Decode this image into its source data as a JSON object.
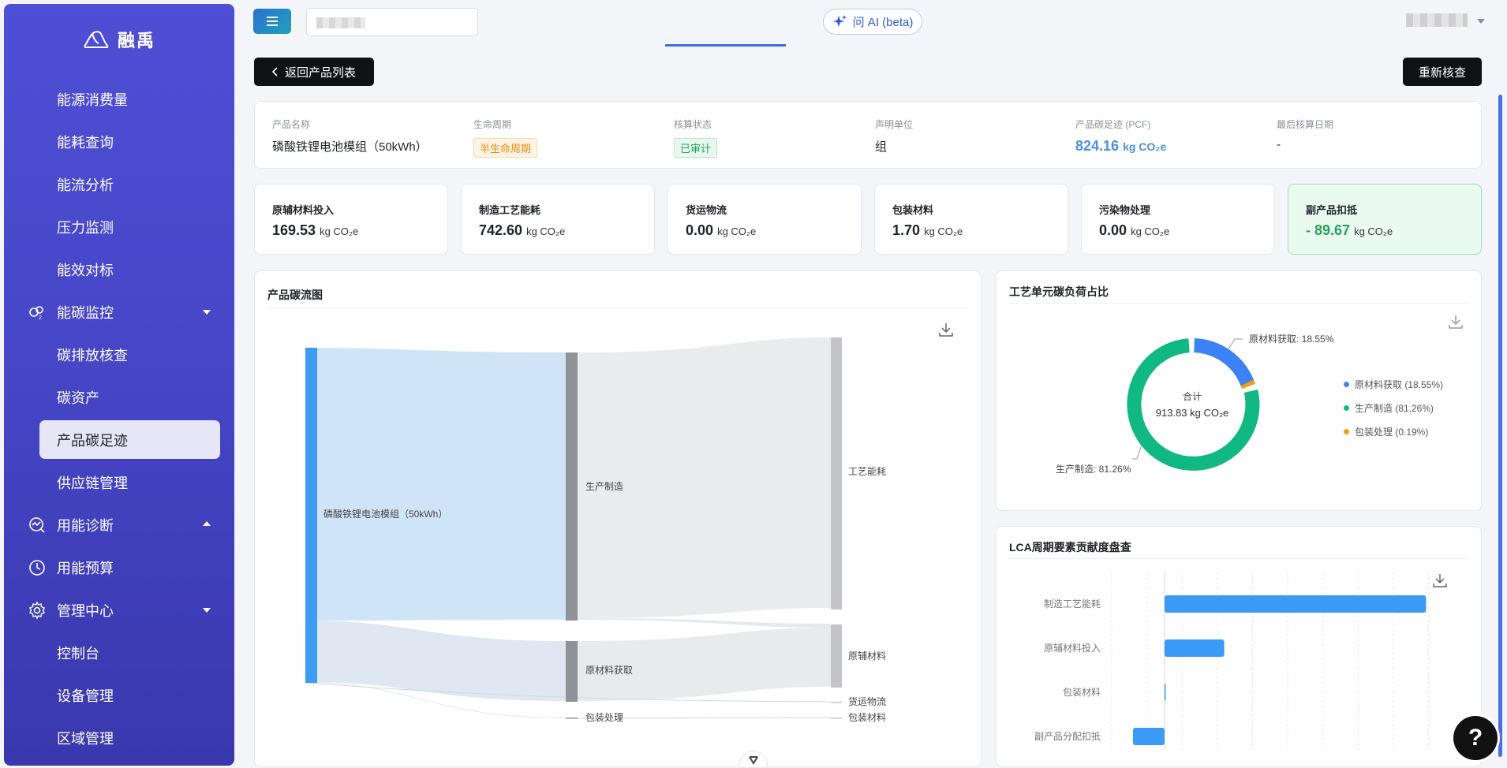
{
  "app": {
    "logo_text": "融禹"
  },
  "sidebar": {
    "items": [
      {
        "label": "能源消费量"
      },
      {
        "label": "能耗查询"
      },
      {
        "label": "能流分析"
      },
      {
        "label": "压力监测"
      },
      {
        "label": "能效对标"
      },
      {
        "label": "能碳监控",
        "icon": "co2-icon",
        "expanded": true
      },
      {
        "label": "碳排放核查"
      },
      {
        "label": "碳资产"
      },
      {
        "label": "产品碳足迹",
        "active": true
      },
      {
        "label": "供应链管理"
      },
      {
        "label": "用能诊断",
        "icon": "diagnosis-icon",
        "expanded": false
      },
      {
        "label": "用能预算",
        "icon": "budget-icon"
      },
      {
        "label": "管理中心",
        "icon": "gear-icon",
        "expanded": true
      },
      {
        "label": "控制台"
      },
      {
        "label": "设备管理"
      },
      {
        "label": "区域管理"
      }
    ]
  },
  "topbar": {
    "ai_label": "问 AI (beta)"
  },
  "actions": {
    "back_label": "返回产品列表",
    "recheck_label": "重新核查"
  },
  "product_info": {
    "name_label": "产品名称",
    "name_value": "磷酸铁锂电池模组（50kWh）",
    "lifecycle_label": "生命周期",
    "lifecycle_value": "半生命周期",
    "status_label": "核算状态",
    "status_value": "已审计",
    "unit_label": "声明单位",
    "unit_value": "组",
    "pcf_label": "产品碳足迹 (PCF)",
    "pcf_value": "824.16",
    "pcf_unit": "kg CO₂e",
    "date_label": "最后核算日期",
    "date_value": "-"
  },
  "metrics": [
    {
      "label": "原辅材料投入",
      "value": "169.53",
      "unit": "kg CO₂e"
    },
    {
      "label": "制造工艺能耗",
      "value": "742.60",
      "unit": "kg CO₂e"
    },
    {
      "label": "货运物流",
      "value": "0.00",
      "unit": "kg CO₂e"
    },
    {
      "label": "包装材料",
      "value": "1.70",
      "unit": "kg CO₂e"
    },
    {
      "label": "污染物处理",
      "value": "0.00",
      "unit": "kg CO₂e"
    },
    {
      "label": "副产品扣抵",
      "value": "- 89.67",
      "unit": "kg CO₂e"
    }
  ],
  "sankey": {
    "title": "产品碳流图",
    "source": "磷酸铁锂电池模组（50kWh）",
    "stages": [
      "生产制造",
      "原材料获取",
      "包装处理"
    ],
    "targets": [
      "工艺能耗",
      "原辅材料",
      "货运物流",
      "包装材料"
    ]
  },
  "donut": {
    "title": "工艺单元碳负荷占比",
    "center_label": "合计",
    "center_value": "913.83 kg CO₂e",
    "callout_top": "原材料获取: 18.55%",
    "callout_bottom": "生产制造: 81.26%",
    "legend": [
      {
        "label": "原材料获取 (18.55%)",
        "color": "#3b82f6"
      },
      {
        "label": "生产制造 (81.26%)",
        "color": "#10b981"
      },
      {
        "label": "包装处理 (0.19%)",
        "color": "#f59e0b"
      }
    ]
  },
  "chart_data": {
    "type": "bar",
    "title": "LCA周期要素贡献度盘查",
    "categories": [
      "制造工艺能耗",
      "原辅材料投入",
      "包装材料",
      "副产品分配扣抵"
    ],
    "values": [
      742.6,
      169.53,
      1.7,
      -89.67
    ],
    "xlim": [
      -150,
      800
    ]
  }
}
